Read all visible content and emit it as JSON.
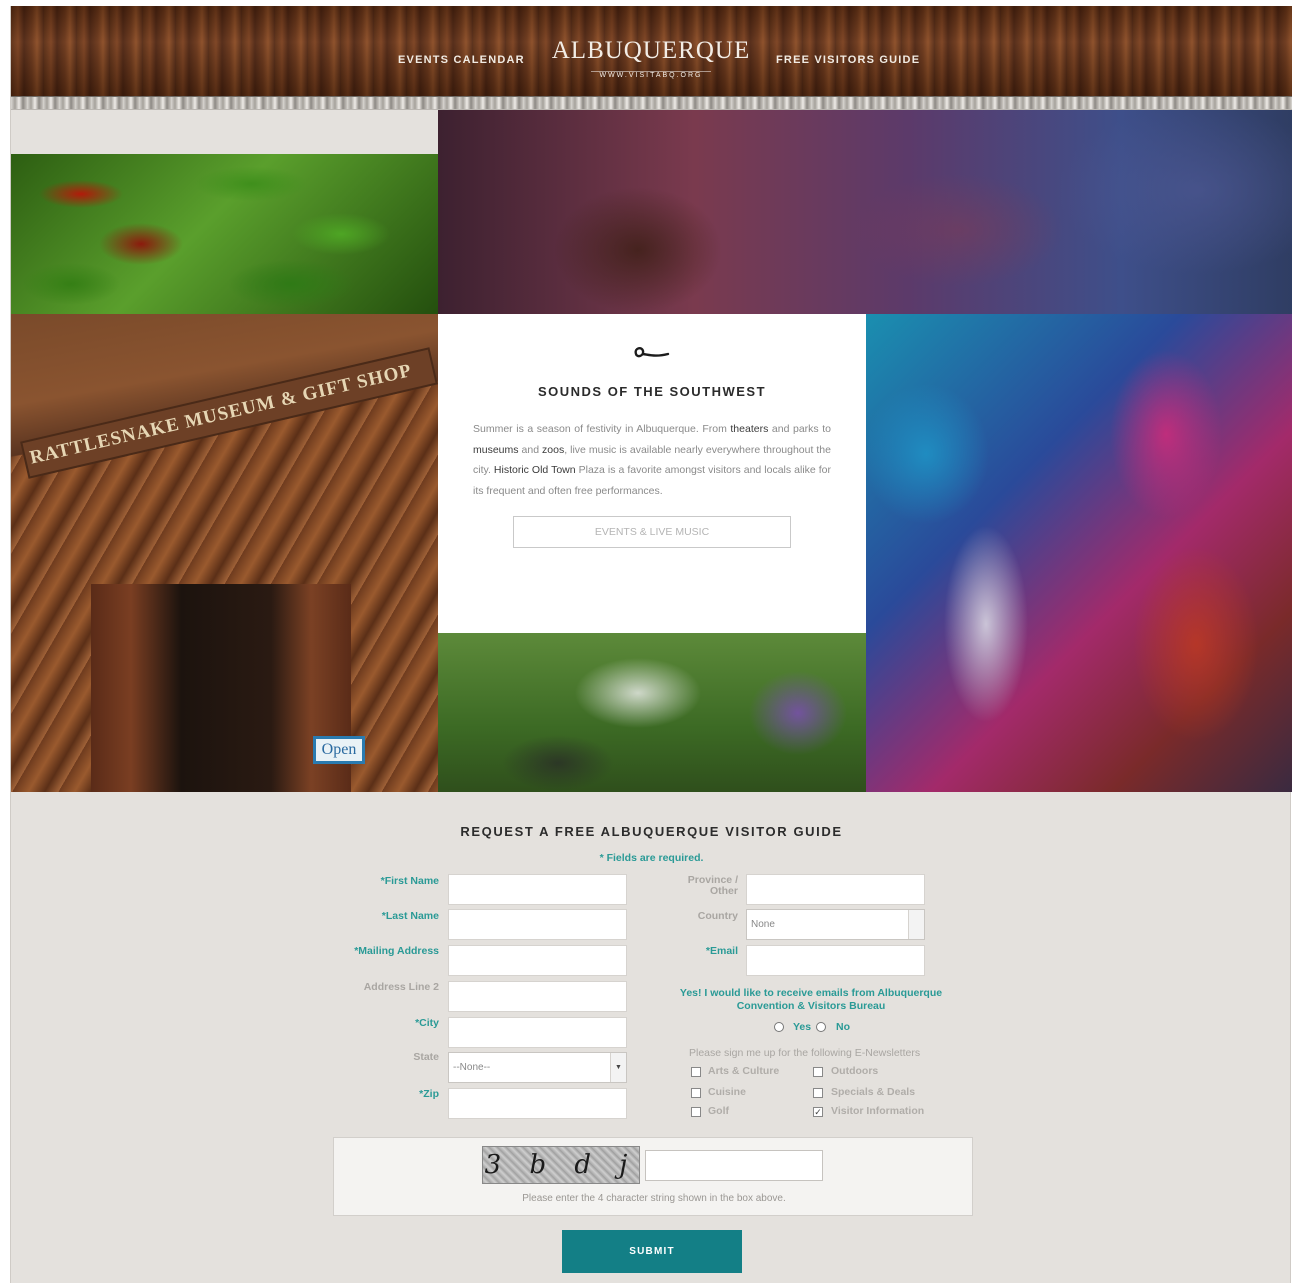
{
  "header": {
    "nav_left": "EVENTS CALENDAR",
    "nav_right": "FREE VISITORS GUIDE",
    "logo_word": "ALBUQUERQUE",
    "logo_url": "WWW.VISITABQ.ORG"
  },
  "feature": {
    "icon": "squiggle-icon",
    "title": "SOUNDS OF THE SOUTHWEST",
    "body": {
      "p1": "Summer is a season of festivity in Albuquerque. From ",
      "link1": "theaters",
      "p2": " and parks to ",
      "link2": "museums",
      "p3": " and ",
      "link3": "zoos",
      "p4": ", live music is available nearly everywhere throughout the city. ",
      "link4": "Historic Old Town",
      "p5": " Plaza is a favorite amongst visitors and locals alike for its frequent and often free performances."
    },
    "button": "EVENTS & LIVE MUSIC"
  },
  "photos": {
    "museum_sign": "RATTLESNAKE MUSEUM & GIFT SHOP",
    "open_sign": "Open"
  },
  "form": {
    "title": "REQUEST A FREE ALBUQUERQUE VISITOR GUIDE",
    "required_note": "* Fields are required.",
    "labels": {
      "first_name": "*First Name",
      "last_name": "*Last Name",
      "mailing_address": "*Mailing Address",
      "address_line2": "Address Line 2",
      "city": "*City",
      "state": "State",
      "zip": "*Zip",
      "province_1": "Province /",
      "province_2": "Other",
      "country": "Country",
      "email": "*Email"
    },
    "state_value": "--None--",
    "country_value": "None",
    "email_optin": "Yes! I would like to receive emails from Albuquerque Convention & Visitors Bureau",
    "yes": "Yes",
    "no": "No",
    "newsletters_label": "Please sign me up for the following E-Newsletters",
    "newsletters": [
      {
        "label": "Arts & Culture",
        "checked": false
      },
      {
        "label": "Outdoors",
        "checked": false
      },
      {
        "label": "Cuisine",
        "checked": false
      },
      {
        "label": "Specials & Deals",
        "checked": false
      },
      {
        "label": "Golf",
        "checked": false
      },
      {
        "label": "Visitor Information",
        "checked": true
      }
    ],
    "captcha_text": "3 b d j",
    "captcha_hint": "Please enter the 4 character string shown in the box above.",
    "submit": "SUBMIT"
  },
  "colors": {
    "accent": "#137f86",
    "required_text": "#2a9a96",
    "form_bg": "#e4e1dd"
  }
}
